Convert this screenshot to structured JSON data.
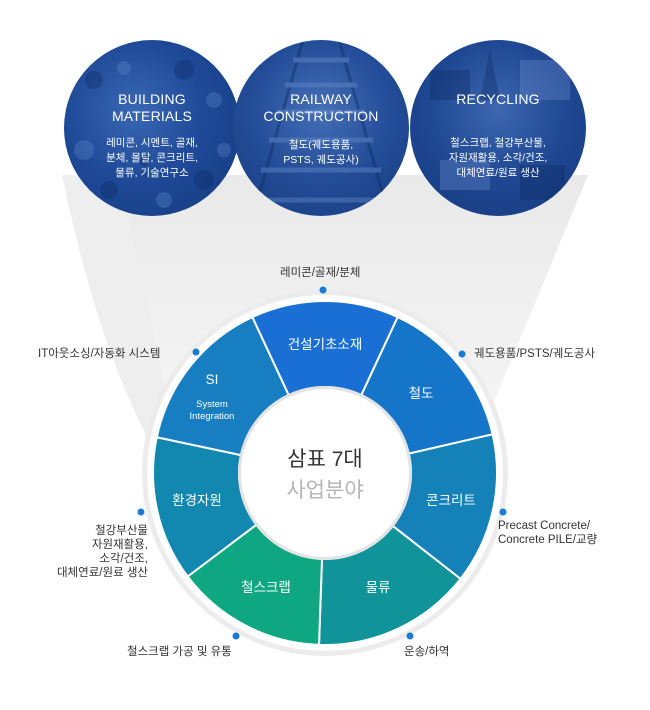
{
  "top_circles": [
    {
      "title_line1": "BUILDING",
      "title_line2": "MATERIALS",
      "sub_line1": "레미콘, 시멘트, 골재,",
      "sub_line2": "분체, 몰탈, 콘크리트,",
      "sub_line3": "물류, 기술연구소"
    },
    {
      "title_line1": "RAILWAY",
      "title_line2": "CONSTRUCTION",
      "sub_line1": "철도(궤도용품,",
      "sub_line2": "PSTS, 궤도공사)"
    },
    {
      "title_line1": "RECYCLING",
      "sub_line1": "철스크랩, 철강부산물,",
      "sub_line2": "자원재활용, 소각/건조,",
      "sub_line3": "대체연료/원료 생산"
    }
  ],
  "center": {
    "line1": "삼표 7대",
    "line2": "사업분야"
  },
  "segments": {
    "construction": "건설기초소재",
    "railway": "철도",
    "concrete": "콘크리트",
    "logistics": "물류",
    "scrap": "철스크랩",
    "environment": "환경자원",
    "si_title": "SI",
    "si_sub1": "System",
    "si_sub2": "Integration"
  },
  "side_labels": {
    "top": "레미콘/골재/분체",
    "upper_right": "궤도용품/PSTS/궤도공사",
    "right_line1": "Precast Concrete/",
    "right_line2": "Concrete PILE/교량",
    "bottom_right": "운송/하역",
    "bottom_left": "철스크랩 가공 및 유통",
    "left_line1": "철강부산물",
    "left_line2": "자원재활용,",
    "left_line3": "소각/건조,",
    "left_line4": "대체연료/원료 생산",
    "upper_left": "IT아웃소싱/자동화 시스템"
  },
  "colors": {
    "construction": "#1a6fd4",
    "railway": "#1576c9",
    "concrete": "#1482b8",
    "logistics": "#10949a",
    "scrap": "#0fa682",
    "environment": "#1288b0",
    "si": "#177fc1",
    "circle_blue": "#1d4fa0",
    "dot": "#1b7bd0"
  }
}
